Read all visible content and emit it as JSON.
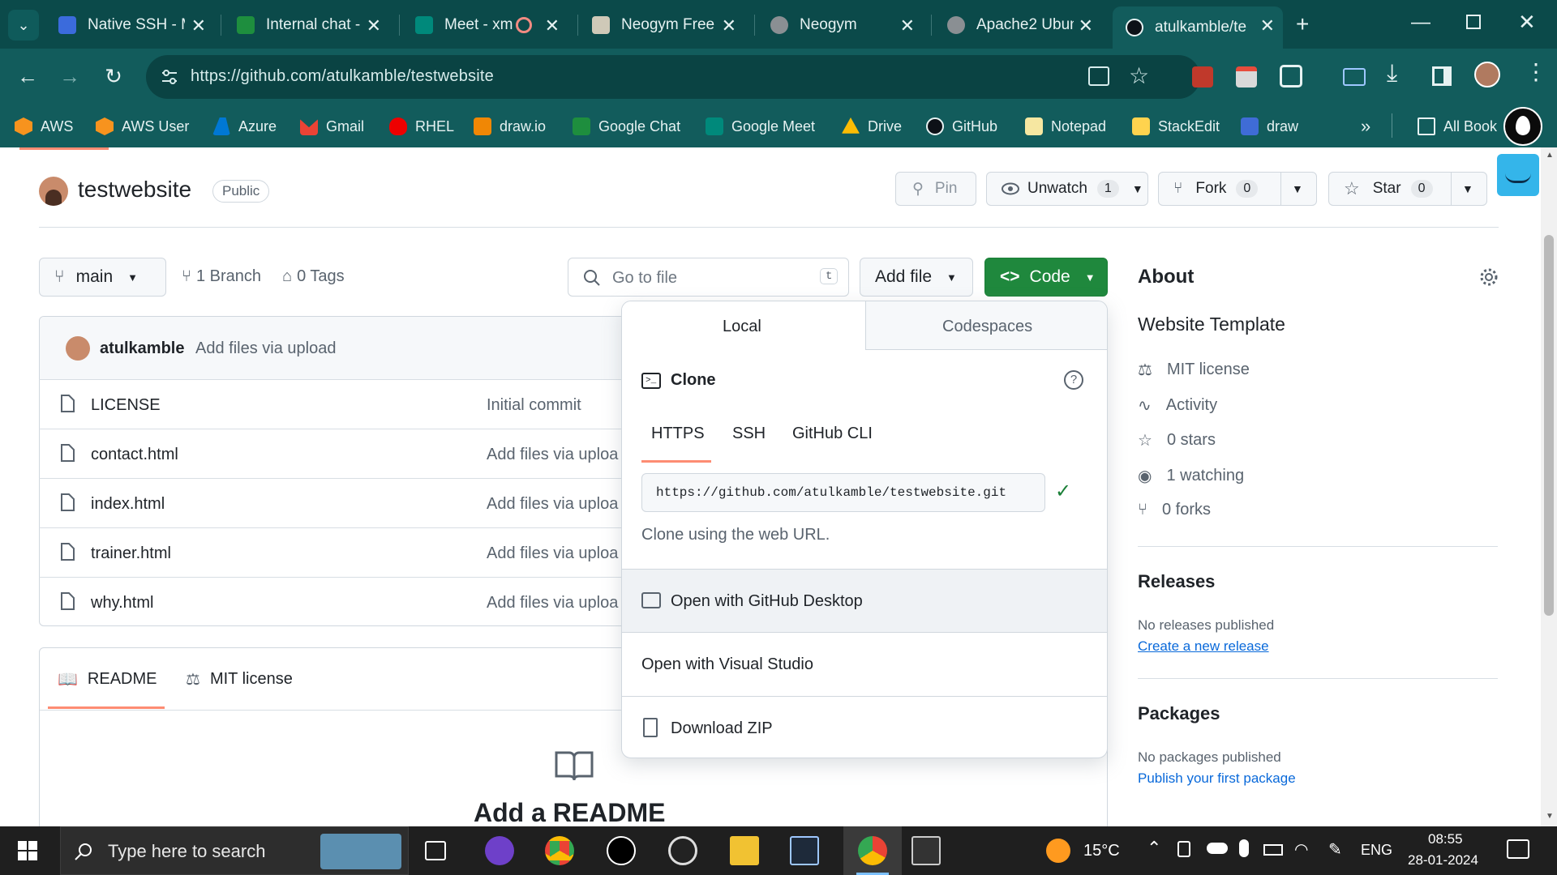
{
  "browser": {
    "tabs": [
      {
        "title": "Native SSH - M",
        "color": "#3b6bdc"
      },
      {
        "title": "Internal chat -",
        "color": "#1e8e3e"
      },
      {
        "title": "Meet - xm",
        "color": "#00897b"
      },
      {
        "title": "Neogym Free",
        "color": "#cfc9b8"
      },
      {
        "title": "Neogym",
        "color": "#8a8f93"
      },
      {
        "title": "Apache2 Ubun",
        "color": "#8a8f93"
      },
      {
        "title": "atulkamble/te",
        "color": "#0d1117"
      }
    ],
    "url": "https://github.com/atulkamble/testwebsite",
    "bookmarks": [
      {
        "label": "AWS",
        "color": "#f7931e"
      },
      {
        "label": "AWS User",
        "color": "#f7931e"
      },
      {
        "label": "Azure",
        "color": "#0078d4"
      },
      {
        "label": "Gmail",
        "color": "#ea4335"
      },
      {
        "label": "RHEL",
        "color": "#ee0000"
      },
      {
        "label": "draw.io",
        "color": "#f08705"
      },
      {
        "label": "Google Chat",
        "color": "#1e8e3e"
      },
      {
        "label": "Google Meet",
        "color": "#00897b"
      },
      {
        "label": "Drive",
        "color": "#fbbc04"
      },
      {
        "label": "GitHub",
        "color": "#0d1117"
      },
      {
        "label": "Notepad",
        "color": "#f6e7a1"
      },
      {
        "label": "StackEdit",
        "color": "#ffd34e"
      },
      {
        "label": "draw",
        "color": "#3f6cd6"
      }
    ],
    "all_bookmarks": "All Book"
  },
  "repo": {
    "name": "testwebsite",
    "visibility": "Public",
    "pin": "Pin",
    "unwatch": "Unwatch",
    "watch_count": "1",
    "fork": "Fork",
    "fork_count": "0",
    "star": "Star",
    "star_count": "0"
  },
  "branchbar": {
    "branch": "main",
    "branches": "1 Branch",
    "tags": "0 Tags",
    "go_to_file_placeholder": "Go to file",
    "shortcut_key": "t",
    "add_file": "Add file",
    "code": "Code"
  },
  "commit": {
    "author": "atulkamble",
    "message": "Add files via upload"
  },
  "files": [
    {
      "name": "LICENSE",
      "message": "Initial commit"
    },
    {
      "name": "contact.html",
      "message": "Add files via uploa"
    },
    {
      "name": "index.html",
      "message": "Add files via uploa"
    },
    {
      "name": "trainer.html",
      "message": "Add files via uploa"
    },
    {
      "name": "why.html",
      "message": "Add files via uploa"
    }
  ],
  "readme": {
    "tab_readme": "README",
    "tab_license": "MIT license",
    "heading": "Add a README"
  },
  "dropdown": {
    "tab_local": "Local",
    "tab_codespaces": "Codespaces",
    "clone_title": "Clone",
    "proto_https": "HTTPS",
    "proto_ssh": "SSH",
    "proto_cli": "GitHub CLI",
    "clone_url": "https://github.com/atulkamble/testwebsite.git",
    "clone_hint": "Clone using the web URL.",
    "open_desktop": "Open with GitHub Desktop",
    "open_vs": "Open with Visual Studio",
    "download_zip": "Download ZIP"
  },
  "about": {
    "title": "About",
    "description": "Website Template",
    "license": "MIT license",
    "activity": "Activity",
    "stars": "0 stars",
    "watching": "1 watching",
    "forks": "0 forks",
    "releases_title": "Releases",
    "releases_none": "No releases published",
    "releases_link": "Create a new release",
    "packages_title": "Packages",
    "packages_none": "No packages published",
    "packages_link": "Publish your first package"
  },
  "taskbar": {
    "search_placeholder": "Type here to search",
    "temperature": "15°C",
    "language": "ENG",
    "time": "08:55",
    "date": "28-01-2024"
  },
  "colors": {
    "chrome_dark": "#0b4a4a",
    "chrome": "#125c5c",
    "code_green": "#1f883d",
    "link_blue": "#0969da",
    "underline_orange": "#fd8c73"
  }
}
